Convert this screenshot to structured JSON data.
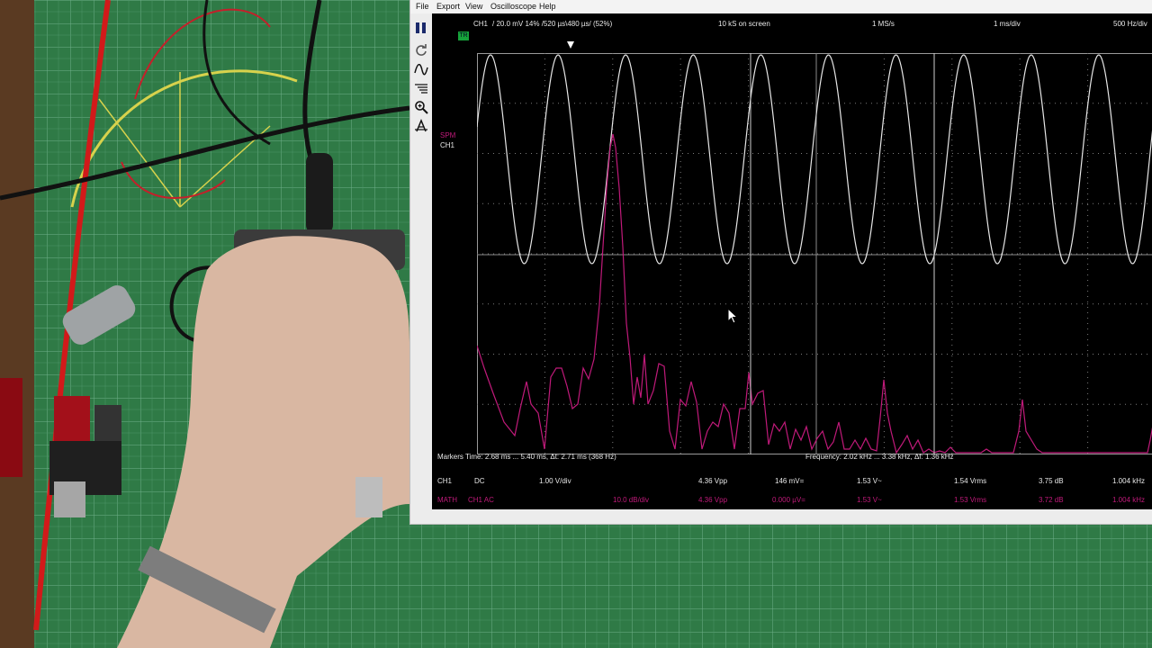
{
  "menu": {
    "items": [
      "File",
      "Export",
      "View",
      "Oscilloscope",
      "Help"
    ]
  },
  "toolbar": {
    "icons": [
      "pause-icon",
      "refresh-icon",
      "waveform-icon",
      "list-icon",
      "zoom-icon",
      "measure-icon"
    ]
  },
  "trigger_badge": "TR",
  "header": {
    "channel": "CH1",
    "scale_info": "/ 20.0 mV 14% /520 µs\\480 µs/ (52%)",
    "samples": "10 kS on screen",
    "rate": "1 MS/s",
    "timebase": "1 ms/div",
    "freq_div": "500 Hz/div"
  },
  "labels": {
    "math": "SPM",
    "ch1": "CH1"
  },
  "markers": {
    "time": "Markers  Time: 2.68 ms ... 5.40 ms,  Δt: 2.71 ms (368 Hz)",
    "frequency": "Frequency: 2.02 kHz ... 3.38 kHz,  Δf: 1.36 kHz",
    "marker1": "1",
    "marker2": "2"
  },
  "measurements": {
    "ch1": {
      "name": "CH1",
      "coupling": "DC",
      "scale": "1.00 V/div",
      "vpp": "4.36 Vpp",
      "dc": "146 mV=",
      "ac": "1.53 V~",
      "rms": "1.54 Vrms",
      "db": "3.75 dB",
      "freq": "1.004 kHz"
    },
    "math": {
      "name": "MATH",
      "coupling": "CH1 AC",
      "scale": "10.0 dB/div",
      "vpp": "4.36 Vpp",
      "dc": "0.000 µV=",
      "ac": "1.53 V~",
      "rms": "1.53 Vrms",
      "db": "3.72 dB",
      "freq": "1.004 kHz"
    }
  },
  "colors": {
    "ch1": "#e6e6e6",
    "math": "#c01a7a",
    "grid": "#777777",
    "trigger": "#16a23a"
  },
  "chart_data": [
    {
      "type": "line",
      "name": "CH1 time-domain",
      "x_unit": "ms",
      "x": [
        0,
        1,
        2,
        3,
        4,
        5,
        6,
        7,
        8,
        9,
        10
      ],
      "values_v_period_ms": 0.996,
      "amplitude_vpp": 4.36,
      "xlim": [
        0,
        10
      ]
    },
    {
      "type": "line",
      "name": "SPM spectrum",
      "x_unit": "Hz",
      "xlim": [
        0,
        5000
      ],
      "y_unit": "dB",
      "peaks_hz": [
        1004,
        2000,
        3000,
        4000,
        5000
      ]
    }
  ]
}
